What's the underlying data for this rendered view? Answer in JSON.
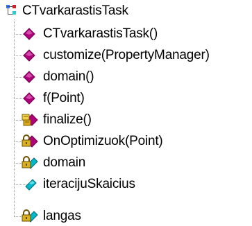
{
  "tree": {
    "root": {
      "label": "CTvarkarastisTask",
      "icon": "class-icon"
    },
    "items": [
      {
        "label": "CTvarkarastisTask()",
        "icon": "public-method-icon"
      },
      {
        "label": "customize(PropertyManager)",
        "icon": "public-method-icon"
      },
      {
        "label": "domain()",
        "icon": "public-method-icon"
      },
      {
        "label": "f(Point)",
        "icon": "public-method-icon"
      },
      {
        "label": "finalize()",
        "icon": "protected-method-icon"
      },
      {
        "label": "OnOptimizuok(Point)",
        "icon": "private-method-icon"
      },
      {
        "label": "domain",
        "icon": "private-field-icon"
      },
      {
        "label": "iteracijuSkaicius",
        "icon": "public-field-icon"
      },
      {
        "label": "langas",
        "icon": "private-field-icon"
      }
    ]
  },
  "colors": {
    "method": "#b0007a",
    "field": "#00b8c8",
    "lock": "#c09a00",
    "class_blue": "#3070ff",
    "class_red": "#d0202a",
    "class_teal": "#30c8c8",
    "line": "#808080"
  }
}
